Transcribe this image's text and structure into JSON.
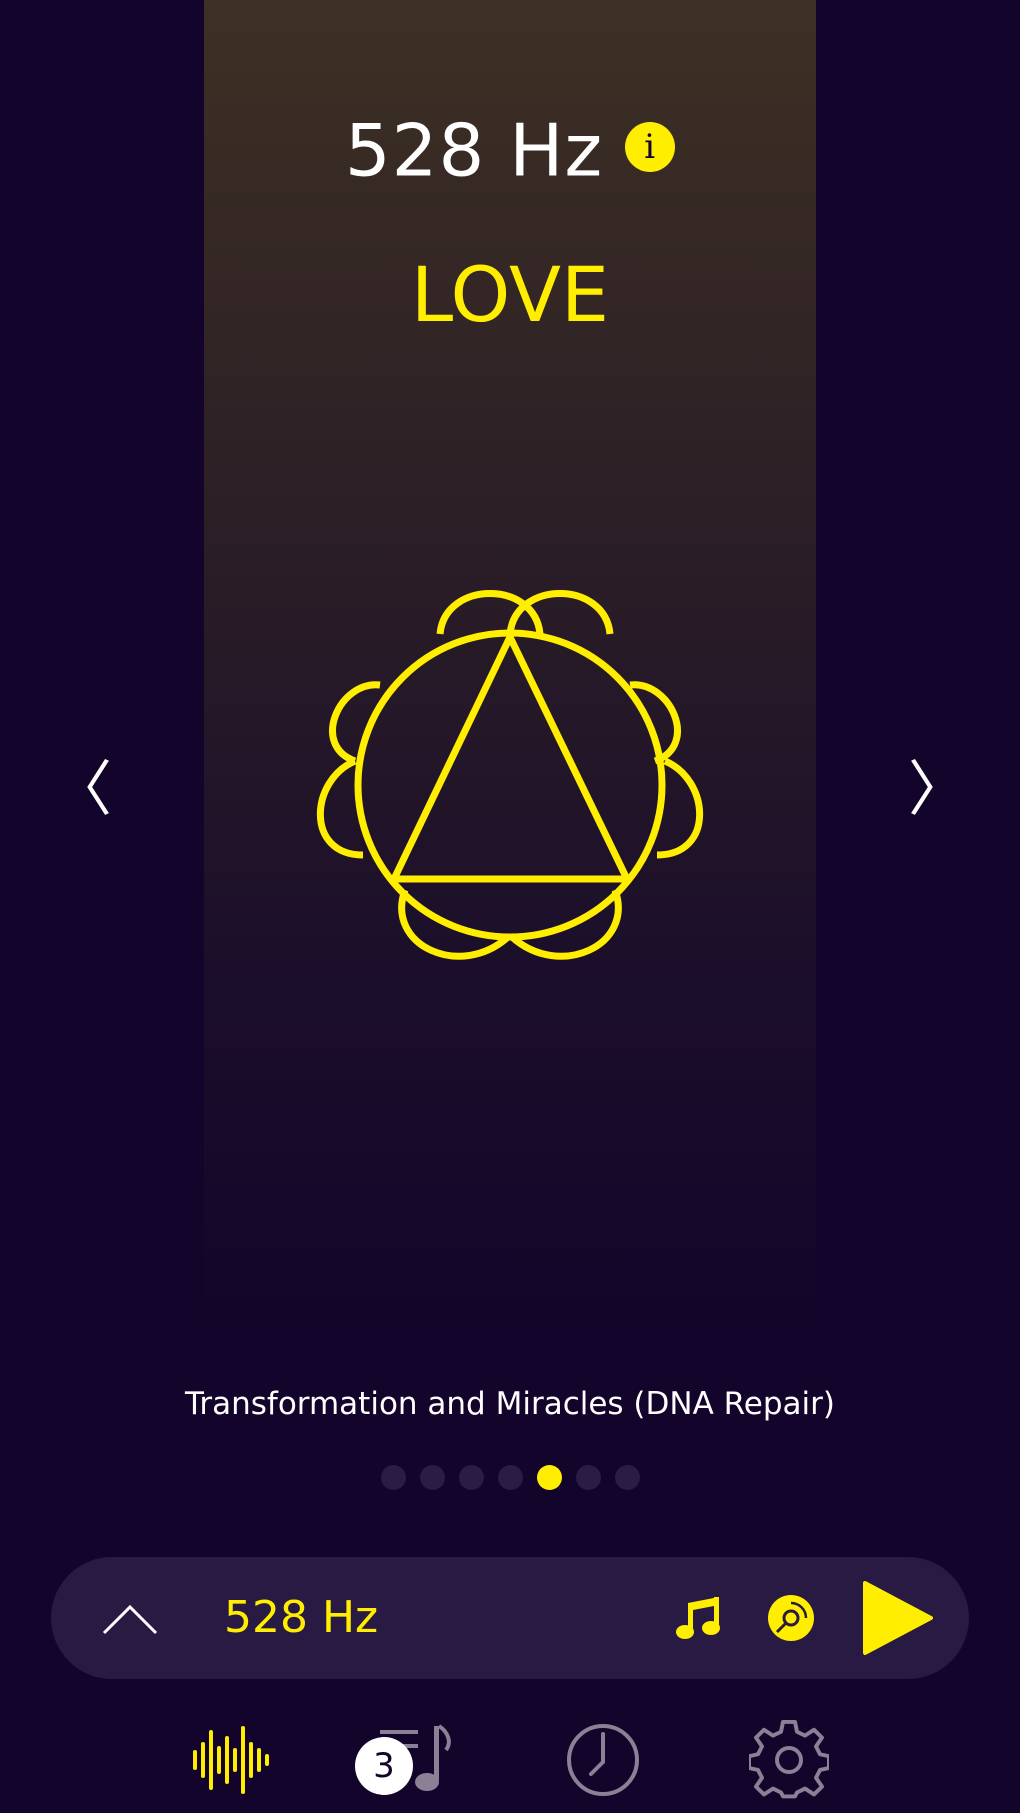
{
  "header": {
    "frequency": "528 Hz",
    "info_icon_glyph": "i",
    "name": "LOVE"
  },
  "symbol": {
    "icon": "solar-plexus-chakra-icon"
  },
  "nav": {
    "prev_glyph": "〈",
    "next_glyph": "〉"
  },
  "description": "Transformation and Miracles (DNA Repair)",
  "pager": {
    "count": 7,
    "active_index": 4
  },
  "player": {
    "title": "528 Hz",
    "icons": [
      "chevron-up-icon",
      "music-note-icon",
      "disc-icon",
      "play-icon"
    ]
  },
  "tabbar": {
    "tabs": [
      "frequencies-tab",
      "playlist-tab",
      "timer-tab",
      "settings-tab"
    ],
    "active_index": 0,
    "playlist_badge": "3"
  },
  "colors": {
    "accent": "#ffee00",
    "background": "#12042a",
    "player_bar": "#281a43",
    "inactive_icon": "#8a8196"
  }
}
